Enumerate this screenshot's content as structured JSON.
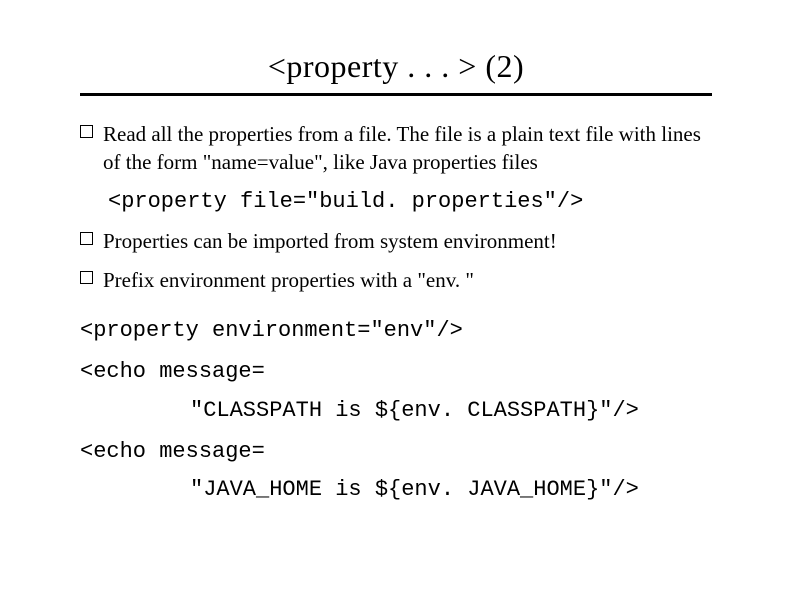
{
  "title": "<property . . . > (2)",
  "bullets": {
    "b1": "Read all the properties from a file. The file is a plain text file with lines of the form \"name=value\", like Java properties files",
    "b2": "Properties can be imported from system environment!",
    "b3": "Prefix environment properties with a \"env. \""
  },
  "code": {
    "c1": "<property file=\"build. properties\"/>",
    "c2": "<property environment=\"env\"/>",
    "c3a": "<echo message=",
    "c3b": "\"CLASSPATH is ${env. CLASSPATH}\"/>",
    "c4a": "<echo message=",
    "c4b": "\"JAVA_HOME is ${env. JAVA_HOME}\"/>"
  }
}
